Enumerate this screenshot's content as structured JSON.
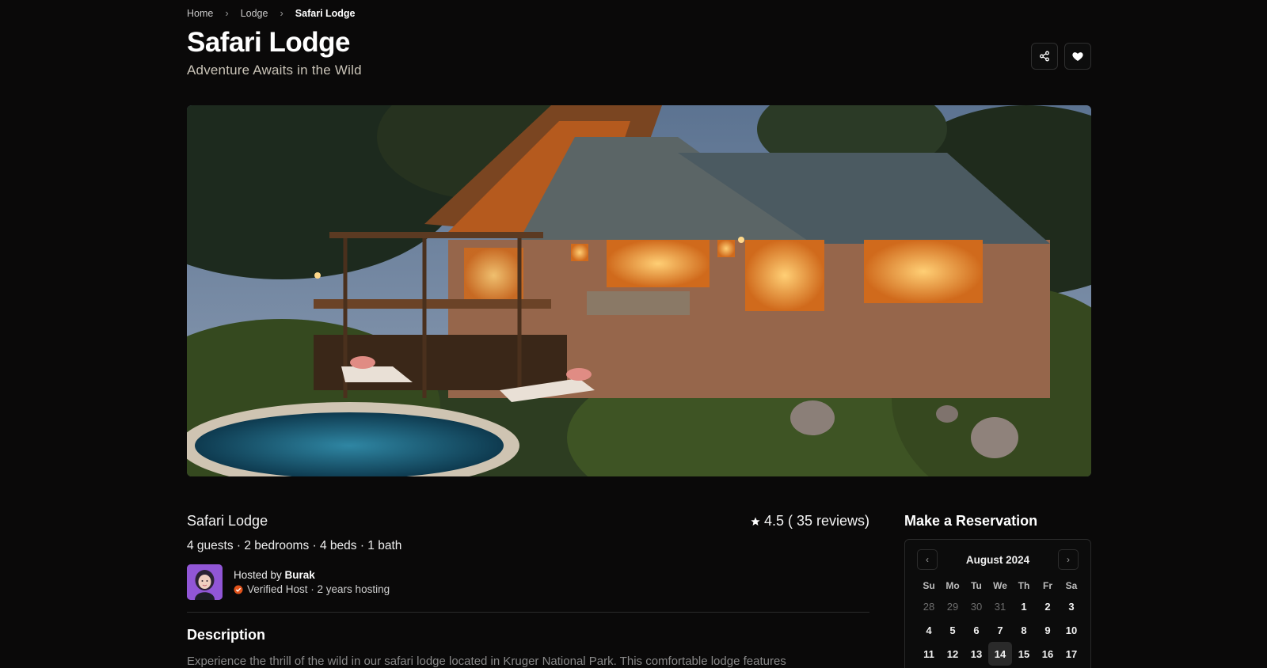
{
  "breadcrumb": {
    "home": "Home",
    "category": "Lodge",
    "current": "Safari Lodge"
  },
  "header": {
    "title": "Safari Lodge",
    "subtitle": "Adventure Awaits in the Wild"
  },
  "actions": {
    "share_icon": "share-icon",
    "favorite_icon": "heart-icon"
  },
  "listing": {
    "name": "Safari Lodge",
    "rating_value": "4.5",
    "rating_reviews": "( 35 reviews)",
    "specs": "4 guests · 2 bedrooms · 4 beds · 1 bath",
    "host_prefix": "Hosted by ",
    "host_name": "Burak",
    "host_status": "Verified Host · 2 years hosting"
  },
  "description": {
    "title": "Description",
    "text": "Experience the thrill of the wild in our safari lodge located in Kruger National Park. This comfortable lodge features"
  },
  "reservation": {
    "title": "Make a Reservation",
    "month": "August 2024",
    "weekdays": [
      "Su",
      "Mo",
      "Tu",
      "We",
      "Th",
      "Fr",
      "Sa"
    ],
    "week1": [
      "28",
      "29",
      "30",
      "31",
      "1",
      "2",
      "3"
    ],
    "week2": [
      "4",
      "5",
      "6",
      "7",
      "8",
      "9",
      "10"
    ],
    "week3": [
      "11",
      "12",
      "13",
      "14",
      "15",
      "16",
      "17"
    ]
  },
  "colors": {
    "background": "#0a0909",
    "accent_verified": "#e2531b"
  }
}
